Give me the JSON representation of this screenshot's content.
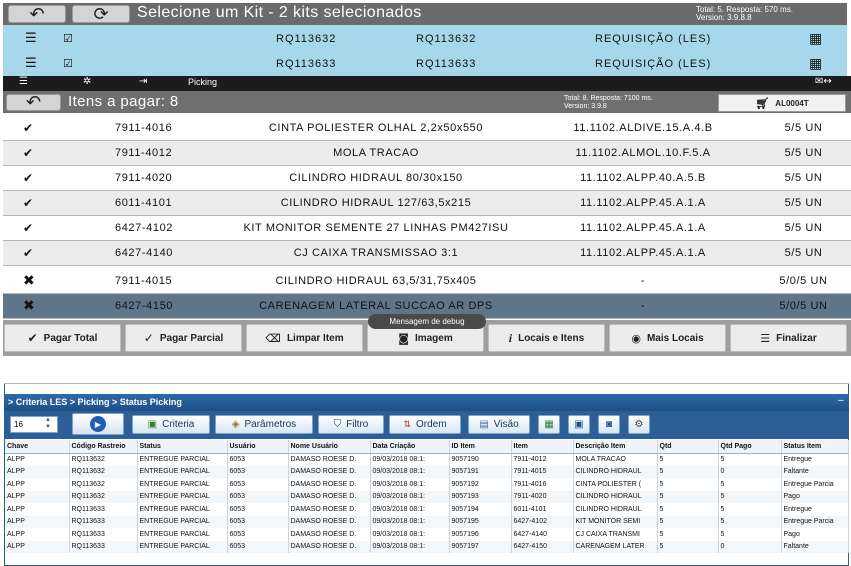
{
  "kit_header": {
    "title": "Selecione um Kit - 2 kits selecionados",
    "stats_line1": "Total: 5. Resposta: 570 ms.",
    "stats_line2": "Version: 3.9.8.8",
    "rows": [
      {
        "code_a": "RQ113632",
        "code_b": "RQ113632",
        "type": "REQUISIÇÃO (LES)"
      },
      {
        "code_a": "RQ113633",
        "code_b": "RQ113633",
        "type": "REQUISIÇÃO (LES)"
      }
    ]
  },
  "nav": {
    "tab_label": "Picking"
  },
  "items_header": {
    "title": "Itens a pagar: 8",
    "stats_line1": "Total: 8. Resposta: 7100 ms.",
    "stats_line2": "Version: 3.9.8",
    "cart_label": "AL0004T"
  },
  "items": [
    {
      "status": "check",
      "code": "7911-4016",
      "desc": "CINTA POLIESTER OLHAL 2,2x50x550",
      "loc": "11.1102.ALDIVE.15.A.4.B",
      "qty": "5/5 UN"
    },
    {
      "status": "check",
      "code": "7911-4012",
      "desc": "MOLA TRACAO",
      "loc": "11.1102.ALMOL.10.F.5.A",
      "qty": "5/5 UN"
    },
    {
      "status": "check",
      "code": "7911-4020",
      "desc": "CILINDRO HIDRAUL 80/30x150",
      "loc": "11.1102.ALPP.40.A.5.B",
      "qty": "5/5 UN"
    },
    {
      "status": "check",
      "code": "6011-4101",
      "desc": "CILINDRO HIDRAUL 127/63,5x215",
      "loc": "11.1102.ALPP.45.A.1.A",
      "qty": "5/5 UN"
    },
    {
      "status": "check",
      "code": "6427-4102",
      "desc": "KIT MONITOR SEMENTE 27 LINHAS PM427ISU",
      "loc": "11.1102.ALPP.45.A.1.A",
      "qty": "5/5 UN"
    },
    {
      "status": "check",
      "code": "6427-4140",
      "desc": "CJ CAIXA TRANSMISSAO 3:1",
      "loc": "11.1102.ALPP.45.A.1.A",
      "qty": "5/5 UN"
    },
    {
      "status": "cross",
      "code": "7911-4015",
      "desc": "CILINDRO HIDRAUL 63,5/31,75x405",
      "loc": "-",
      "qty": "5/0/5 UN"
    },
    {
      "status": "cross",
      "code": "6427-4150",
      "desc": "CARENAGEM LATERAL SUCCAO AR DPS",
      "loc": "-",
      "qty": "5/0/5 UN"
    }
  ],
  "tooltip": "Mensagem de debug",
  "actions": [
    "Pagar Total",
    "Pagar Parcial",
    "Limpar Item",
    "Imagem",
    "Locais e Itens",
    "Mais Locais",
    "Finalizar"
  ],
  "bottom": {
    "breadcrumb": "> Criteria LES > Picking > Status Picking",
    "page_size": "16",
    "toolbar": [
      "Criteria",
      "Parâmetros",
      "Filtro",
      "Ordem",
      "Visão"
    ],
    "columns": [
      "Chave",
      "Código Rastreio",
      "Status",
      "Usuário",
      "Nome Usuário",
      "Data Criação",
      "ID Item",
      "Item",
      "Descrição Item",
      "Qtd",
      "Qtd Pago",
      "Status Item"
    ],
    "rows": [
      [
        "ALPP",
        "RQ113632",
        "ENTREGUE PARCIAL",
        "6053",
        "DAMASO ROESE D.",
        "09/03/2018 08:1:",
        "9057190",
        "7911-4012",
        "MOLA TRACAO",
        "5",
        "5",
        "Entregue"
      ],
      [
        "ALPP",
        "RQ113632",
        "ENTREGUE PARCIAL",
        "6053",
        "DAMASO ROESE D.",
        "09/03/2018 08:1:",
        "9057191",
        "7911-4015",
        "CILINDRO HIDRAUL",
        "5",
        "0",
        "Faltante"
      ],
      [
        "ALPP",
        "RQ113632",
        "ENTREGUE PARCIAL",
        "6053",
        "DAMASO ROESE D.",
        "09/03/2018 08:1:",
        "9057192",
        "7911-4016",
        "CINTA POLIESTER (",
        "5",
        "5",
        "Entregue Parcia"
      ],
      [
        "ALPP",
        "RQ113632",
        "ENTREGUE PARCIAL",
        "6053",
        "DAMASO ROESE D.",
        "09/03/2018 08:1:",
        "9057193",
        "7911-4020",
        "CILINDRO HIDRAUL",
        "5",
        "5",
        "Pago"
      ],
      [
        "ALPP",
        "RQ113633",
        "ENTREGUE PARCIAL",
        "6053",
        "DAMASO ROESE D.",
        "09/03/2018 08:1:",
        "9057194",
        "6011-4101",
        "CILINDRO HIDRAUL",
        "5",
        "5",
        "Entregue"
      ],
      [
        "ALPP",
        "RQ113633",
        "ENTREGUE PARCIAL",
        "6053",
        "DAMASO ROESE D.",
        "09/03/2018 08:1:",
        "9057195",
        "6427-4102",
        "KIT MONITOR SEMI",
        "5",
        "5",
        "Entregue Parcia"
      ],
      [
        "ALPP",
        "RQ113633",
        "ENTREGUE PARCIAL",
        "6053",
        "DAMASO ROESE D.",
        "09/03/2018 08:1:",
        "9057196",
        "6427-4140",
        "CJ CAIXA TRANSMI",
        "5",
        "5",
        "Pago"
      ],
      [
        "ALPP",
        "RQ113633",
        "ENTREGUE PARCIAL",
        "6053",
        "DAMASO ROESE D.",
        "09/03/2018 08:1:",
        "9057197",
        "6427-4150",
        "CARENAGEM LATER",
        "5",
        "0",
        "Faltante"
      ]
    ]
  }
}
